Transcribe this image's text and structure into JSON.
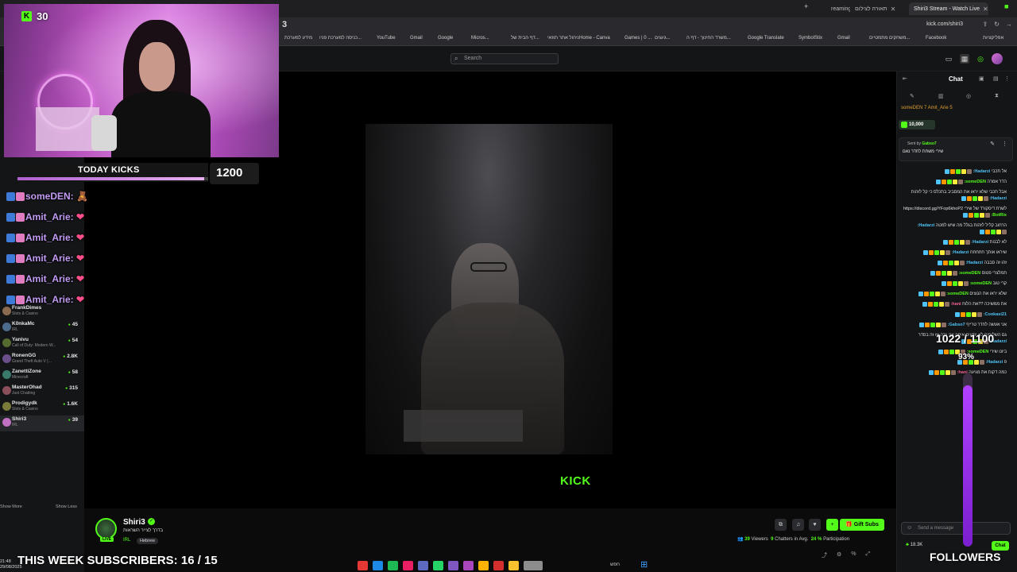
{
  "browser": {
    "tabs": [
      {
        "label": "reaming Store - Streaming",
        "active": false
      },
      {
        "label": "תאורה לצילום",
        "active": false
      },
      {
        "label": "Shiri3 Stream - Watch Live",
        "active": true
      }
    ],
    "url": "kick.com/shiri3",
    "bookmarks": [
      "מידע למערכת",
      "כניסה למערכת פניו...",
      "YouTube",
      "Gmail",
      "Google",
      "Micros...",
      "דף הבית של...",
      "ניהול אתר תוזאי",
      "Home - Canva",
      "Games | 0 ...",
      "גיגגים...",
      "משרד החינוך - דף ה...",
      "Google Translate",
      "SymbolStix",
      "Gmail",
      "משחקים מתמטיים...",
      "Facebook",
      "אפליקציות"
    ]
  },
  "kick_header": {
    "search_placeholder": "Search"
  },
  "sidebar": {
    "channels": [
      {
        "name": "FrankDimes",
        "game": "Slots & Casino",
        "viewers": "",
        "selected": false
      },
      {
        "name": "K0nkaMc",
        "game": "IRL",
        "viewers": "45",
        "selected": false
      },
      {
        "name": "Yanivu",
        "game": "Call of Duty: Modern W...",
        "viewers": "54",
        "selected": false
      },
      {
        "name": "RonenGG",
        "game": "Grand Theft Auto V (...",
        "viewers": "2.8K",
        "selected": false
      },
      {
        "name": "ZanettiZone",
        "game": "Minecraft",
        "viewers": "58",
        "selected": false
      },
      {
        "name": "MasterOhad",
        "game": "Just Chatting",
        "viewers": "315",
        "selected": false
      },
      {
        "name": "Prodigydk",
        "game": "Slots & Casino",
        "viewers": "1.6K",
        "selected": false
      },
      {
        "name": "Shiri3",
        "game": "IRL",
        "viewers": "39",
        "selected": true
      }
    ],
    "show_more": "Show More",
    "show_less": "Show Less"
  },
  "overlay": {
    "kick_count": "30",
    "today_kicks_label": "TODAY KICKS",
    "today_kicks_value": "1200",
    "today_kicks_progress": 0.98,
    "chat_messages": [
      {
        "user": "someDEN:",
        "emote": "🧸"
      },
      {
        "user": "Amit_Arie:",
        "emote": "❤"
      },
      {
        "user": "Amit_Arie:",
        "emote": "❤"
      },
      {
        "user": "Amit_Arie:",
        "emote": "❤"
      },
      {
        "user": "Amit_Arie:",
        "emote": "❤"
      },
      {
        "user": "Amit_Arie:",
        "emote": "❤"
      }
    ],
    "goal_text": "1022 / 1100",
    "goal_pct": "93%",
    "goal_fraction": 0.93,
    "subs_text": "THIS WEEK SUBSCRIBERS: 16 / 15",
    "followers_text": "FOLLOWERS"
  },
  "video": {
    "watermark": "KICK"
  },
  "stream_info": {
    "streamer": "Shiri3",
    "title": "בדרך לצייר השראות",
    "category": "IRL",
    "language": "Hebrew",
    "gift_label": "Gift Subs",
    "viewers": "39",
    "viewers_label": "Viewers",
    "chatters": "9",
    "chatters_label": "Chatters in Avg.",
    "participation": "24 %",
    "participation_label": "Participation",
    "live": "LIVE"
  },
  "chat": {
    "title": "Chat",
    "top_gifters": "someDEN 7   Amit_Arie 5",
    "kicks_badge": "10,000",
    "pinned_by_label": "Sent by",
    "pinned_by_user": "Gabso7",
    "pinned_msg": "שירי משחת לחדר נאם",
    "messages": [
      {
        "user": "Hadarzi:",
        "text": "אל תכבי",
        "color": "#4fc3f7"
      },
      {
        "user": "someDEN:",
        "text": "הדר אמרה",
        "color": "#53fc18"
      },
      {
        "user": "Hadarzi:",
        "text": "אבל תכבי שלא יראו את המסביב בתכלס כי קל לזהות",
        "color": "#4fc3f7"
      },
      {
        "user": "BotRix:",
        "text": "לשרת דיסקורד של שירי https://discord.gg/YFop6khoP2",
        "color": "#53fc18"
      },
      {
        "user": "Hadarzi:",
        "text": "הרחוב קליל לזהות בגלל מה שיש למטה",
        "color": "#4fc3f7"
      },
      {
        "user": "Hadarzi:",
        "text": "לא לבנות",
        "color": "#4fc3f7"
      },
      {
        "user": "Hadarzi:",
        "text": "שיראו אותך חחחחח",
        "color": "#4fc3f7"
      },
      {
        "user": "Hadarzi:",
        "text": "זהו זה סבבה",
        "color": "#4fc3f7"
      },
      {
        "user": "someDEN:",
        "text": "תמלצרי פטוס",
        "color": "#53fc18"
      },
      {
        "user": "someDEN:",
        "text": "קרי טוב",
        "color": "#53fc18"
      },
      {
        "user": "someDEN:",
        "text": "שלא יראו את הנוצים",
        "color": "#53fc18"
      },
      {
        "user": "hani:",
        "text": "את ממשיכה ??את הלוח",
        "color": "#f06292"
      },
      {
        "user": "Cookasi21:",
        "text": "",
        "color": "#4fc3f7"
      },
      {
        "user": "Gabso7:",
        "text": "אני אעשה לחדר טרייף",
        "color": "#4fc3f7"
      },
      {
        "user": "Hadarzi:",
        "text": "גם השליחים לא יודעים איפה אני גרה אז זה בסדר",
        "color": "#4fc3f7"
      },
      {
        "user": "someDEN:",
        "text": "ביונו שירי",
        "color": "#53fc18"
      },
      {
        "user": "Hadarzi:",
        "text": "פ",
        "color": "#4fc3f7"
      },
      {
        "user": "hani:",
        "text": "כמה דקות את מגיעה",
        "color": "#f06292"
      }
    ],
    "input_placeholder": "Send a message",
    "follow_count": "18.3K",
    "send_label": "Chat"
  },
  "taskbar": {
    "time": "21:48",
    "date": "29/08/2025",
    "search_label": "חפש"
  },
  "colors": {
    "kick_green": "#53fc18",
    "goal_purple": "#b040ff",
    "overlay_name": "#c39cf5"
  }
}
